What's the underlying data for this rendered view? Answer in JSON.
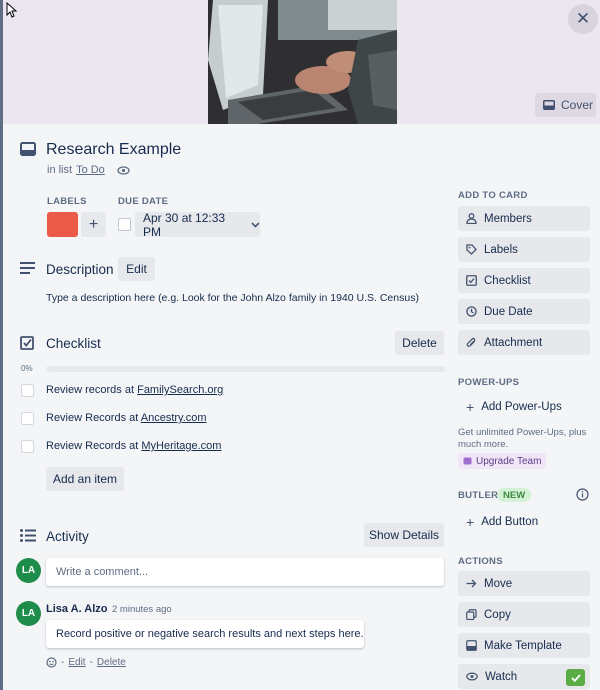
{
  "cover": {
    "button_label": "Cover"
  },
  "card": {
    "title": "Research Example",
    "in_list_prefix": "in list",
    "list_name": "To Do"
  },
  "labels": {
    "heading": "LABELS",
    "color": "#eb5a46"
  },
  "due": {
    "heading": "DUE DATE",
    "value": "Apr 30 at 12:33 PM"
  },
  "description": {
    "title": "Description",
    "edit_label": "Edit",
    "placeholder": "Type a description here (e.g. Look for the John Alzo family in 1940 U.S. Census)"
  },
  "checklist": {
    "title": "Checklist",
    "delete_label": "Delete",
    "percent_label": "0%",
    "progress": 0,
    "items": [
      {
        "prefix": "Review records at ",
        "link": "FamilySearch.org"
      },
      {
        "prefix": "Review Records at ",
        "link": "Ancestry.com"
      },
      {
        "prefix": "Review Records at ",
        "link": "MyHeritage.com"
      }
    ],
    "add_item_label": "Add an item"
  },
  "activity": {
    "title": "Activity",
    "show_details_label": "Show Details",
    "comment_placeholder": "Write a comment...",
    "avatar_initials": "LA",
    "comment": {
      "author": "Lisa A. Alzo",
      "time": "2 minutes ago",
      "text": "Record positive or negative search results and next steps here.",
      "separator": "-",
      "edit_label": "Edit",
      "delete_label": "Delete"
    }
  },
  "sidebar": {
    "add_to_card_heading": "ADD TO CARD",
    "add_to_card": [
      {
        "label": "Members",
        "icon": "person-icon"
      },
      {
        "label": "Labels",
        "icon": "tag-icon"
      },
      {
        "label": "Checklist",
        "icon": "checkbox-icon"
      },
      {
        "label": "Due Date",
        "icon": "clock-icon"
      },
      {
        "label": "Attachment",
        "icon": "paperclip-icon"
      }
    ],
    "powerups_heading": "POWER-UPS",
    "add_powerups_label": "Add Power-Ups",
    "powerups_note": "Get unlimited Power-Ups, plus much more.",
    "upgrade_label": "Upgrade Team",
    "butler_heading": "BUTLER",
    "butler_badge": "NEW",
    "add_button_label": "Add Button",
    "actions_heading": "ACTIONS",
    "actions": [
      {
        "label": "Move",
        "icon": "arrow-right-icon"
      },
      {
        "label": "Copy",
        "icon": "copy-icon"
      },
      {
        "label": "Make Template",
        "icon": "template-icon"
      },
      {
        "label": "Watch",
        "icon": "eye-icon"
      }
    ]
  },
  "colors": {
    "accent_green": "#5aac44",
    "label_red": "#eb5a46",
    "avatar_green": "#1e8c4a"
  }
}
